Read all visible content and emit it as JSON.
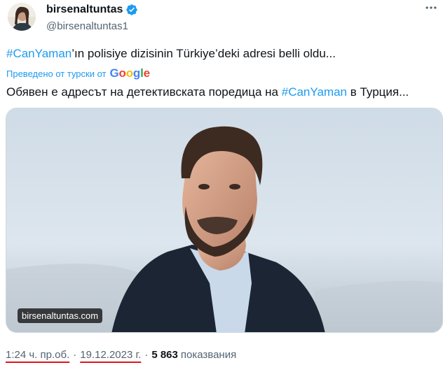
{
  "author": {
    "display_name": "birsenaltuntas",
    "handle": "@birsenaltuntas1",
    "verified_badge_icon": "verified-badge-icon",
    "badge_color": "#1d9bf0"
  },
  "tweet": {
    "hashtag": "#CanYaman",
    "text_rest": "’ın polisiye dizisinin Türkiye’deki adresi belli oldu...",
    "translated_by_label": "Преведено от турски от",
    "translator_brand": "Google",
    "translated_prefix": "Обявен е адресът на детективската поредица на ",
    "translated_hashtag": "#CanYaman",
    "translated_suffix": " в Турция..."
  },
  "media": {
    "caption": "birsenaltuntas.com"
  },
  "meta": {
    "time": "1:24 ч. пр.об.",
    "dot1": "·",
    "date": "19.12.2023 г.",
    "dot2": "·",
    "views_count": "5 863",
    "views_label": "показвания"
  },
  "colors": {
    "accent": "#1d9bf0",
    "text": "#0f1419",
    "secondary": "#536471",
    "underline_highlight": "#e0161b"
  }
}
